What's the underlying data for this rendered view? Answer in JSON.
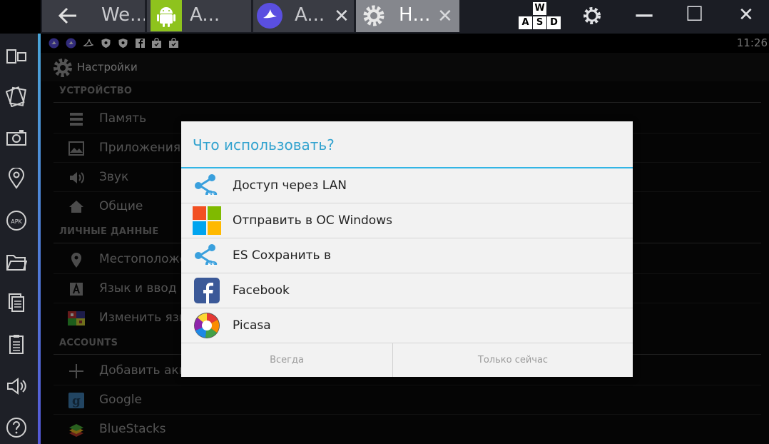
{
  "tabs": [
    {
      "label": "We...",
      "icon": "back-arrow-icon"
    },
    {
      "label": "A...",
      "icon": "android-icon"
    },
    {
      "label": "A...",
      "icon": "aviate-icon",
      "close": "✕"
    },
    {
      "label": "Н...",
      "icon": "gear-icon",
      "close": "✕"
    }
  ],
  "keyboard_keys": {
    "top": "W",
    "bottom": [
      "A",
      "S",
      "D"
    ]
  },
  "window_controls": {
    "minimize": "—",
    "maximize": "☐",
    "close": "✕"
  },
  "statusbar": {
    "clock": "11:26"
  },
  "actionbar": {
    "title": "Настройки"
  },
  "settings": {
    "sections": [
      {
        "header": "УСТРОЙСТВО",
        "items": [
          "Память",
          "Приложения",
          "Звук",
          "Общие"
        ]
      },
      {
        "header": "ЛИЧНЫЕ ДАННЫЕ",
        "items": [
          "Местоположе",
          "Язык и ввод",
          "Изменить язы"
        ]
      },
      {
        "header": "ACCOUNTS",
        "items": [
          "Добавить акк",
          "Google",
          "BlueStacks"
        ]
      }
    ]
  },
  "dialog": {
    "title": "Что использовать?",
    "options": [
      {
        "label": "Доступ через LAN",
        "icon": "es-share-icon"
      },
      {
        "label": "Отправить в ОС Windows",
        "icon": "windows-icon"
      },
      {
        "label": "ES Сохранить в",
        "icon": "es-share-icon"
      },
      {
        "label": "Facebook",
        "icon": "facebook-icon"
      },
      {
        "label": "Picasa",
        "icon": "picasa-icon"
      }
    ],
    "buttons": {
      "always": "Всегда",
      "just_once": "Только сейчас"
    }
  },
  "colors": {
    "accent": "#33b5e5",
    "dialog_bg": "#f2f2f2",
    "sidebar_accent_top": "#4aa6d9",
    "sidebar_accent_bottom": "#5558d6"
  }
}
